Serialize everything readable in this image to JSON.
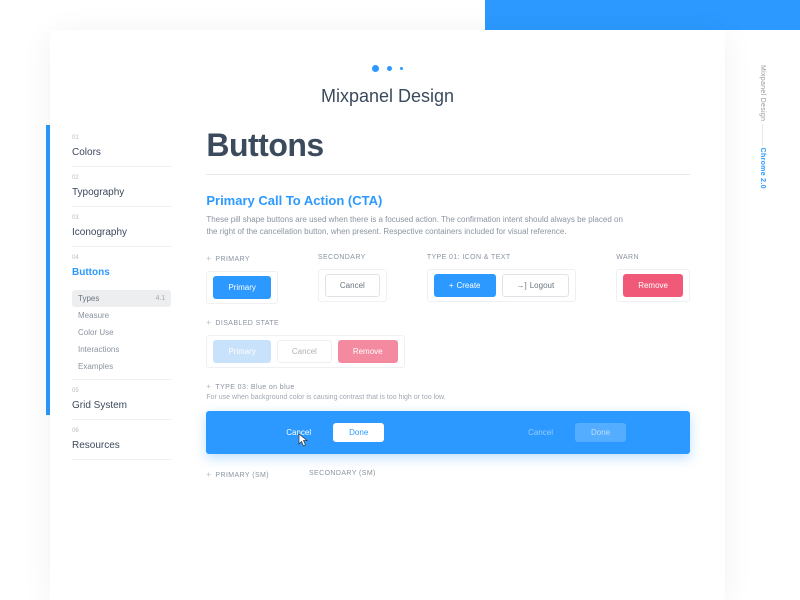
{
  "rail": {
    "brand": "Mixpanel Design",
    "version": "Chrome 2.0"
  },
  "header": {
    "title": "Mixpanel Design"
  },
  "nav": {
    "items": [
      {
        "num": "01",
        "label": "Colors"
      },
      {
        "num": "02",
        "label": "Typography"
      },
      {
        "num": "03",
        "label": "Iconography"
      },
      {
        "num": "04",
        "label": "Buttons"
      },
      {
        "num": "05",
        "label": "Grid System"
      },
      {
        "num": "06",
        "label": "Resources"
      }
    ],
    "subs": [
      {
        "label": "Types",
        "num": "4.1"
      },
      {
        "label": "Measure"
      },
      {
        "label": "Color Use"
      },
      {
        "label": "Interactions"
      },
      {
        "label": "Examples"
      }
    ]
  },
  "page": {
    "h1": "Buttons",
    "h2": "Primary Call To Action (CTA)",
    "desc": "These pill shape buttons are used when there is a focused action. The confirmation intent should always be placed on the right of the cancellation button, when present.  Respective containers included for visual reference."
  },
  "row1": {
    "primary_lbl": "PRIMARY",
    "primary_btn": "Primary",
    "secondary_lbl": "SECONDARY",
    "secondary_btn": "Cancel",
    "type01_lbl": "TYPE 01: Icon & Text",
    "create_btn": "Create",
    "logout_btn": "Logout",
    "warn_lbl": "WARN",
    "warn_btn": "Remove"
  },
  "row2": {
    "lbl": "DISABLED STATE",
    "primary": "Primary",
    "cancel": "Cancel",
    "remove": "Remove"
  },
  "type3": {
    "lbl": "TYPE 03: Blue on blue",
    "sub": "For use when background color is causing contrast that is too high or too low.",
    "cancel1": "Cancel",
    "done1": "Done",
    "cancel2": "Cancel",
    "done2": "Done"
  },
  "row4": {
    "primary_sm": "PRIMARY (SM)",
    "secondary_sm": "SECONDARY (SM)"
  }
}
